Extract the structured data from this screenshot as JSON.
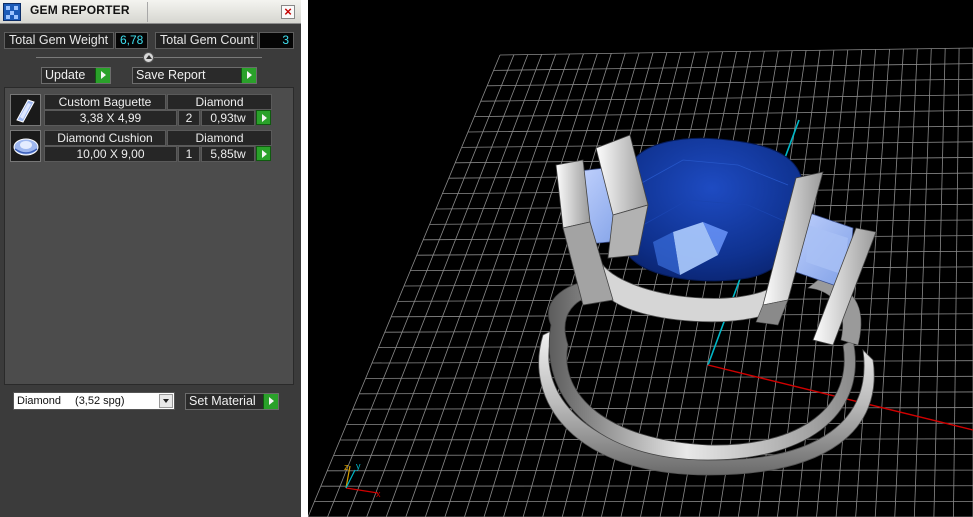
{
  "window": {
    "title": "GEM REPORTER"
  },
  "summary": {
    "weight_label": "Total Gem Weight",
    "weight_value": "6,78",
    "count_label": "Total Gem Count",
    "count_value": "3"
  },
  "toolbar": {
    "update_label": "Update",
    "save_label": "Save Report"
  },
  "gems": [
    {
      "name": "Custom Baguette",
      "material": "Diamond",
      "size": "3,38 X 4,99",
      "qty": "2",
      "weight": "0,93tw",
      "icon": "baguette-gem-icon"
    },
    {
      "name": "Diamond Cushion",
      "material": "Diamond",
      "size": "10,00 X 9,00",
      "qty": "1",
      "weight": "5,85tw",
      "icon": "cushion-gem-icon"
    }
  ],
  "material": {
    "selected_name": "Diamond",
    "selected_spg": "(3,52 spg)",
    "set_label": "Set Material"
  },
  "viewport": {
    "axis_labels": {
      "x": "x",
      "y": "y",
      "z": "z"
    },
    "colors": {
      "grid": "#8a8a8a",
      "x_axis": "#d00000",
      "y_axis": "#00b8c8",
      "gem": "#123a9e",
      "metal": "#c9c9c9",
      "side_stone": "#9ab4e8"
    }
  }
}
